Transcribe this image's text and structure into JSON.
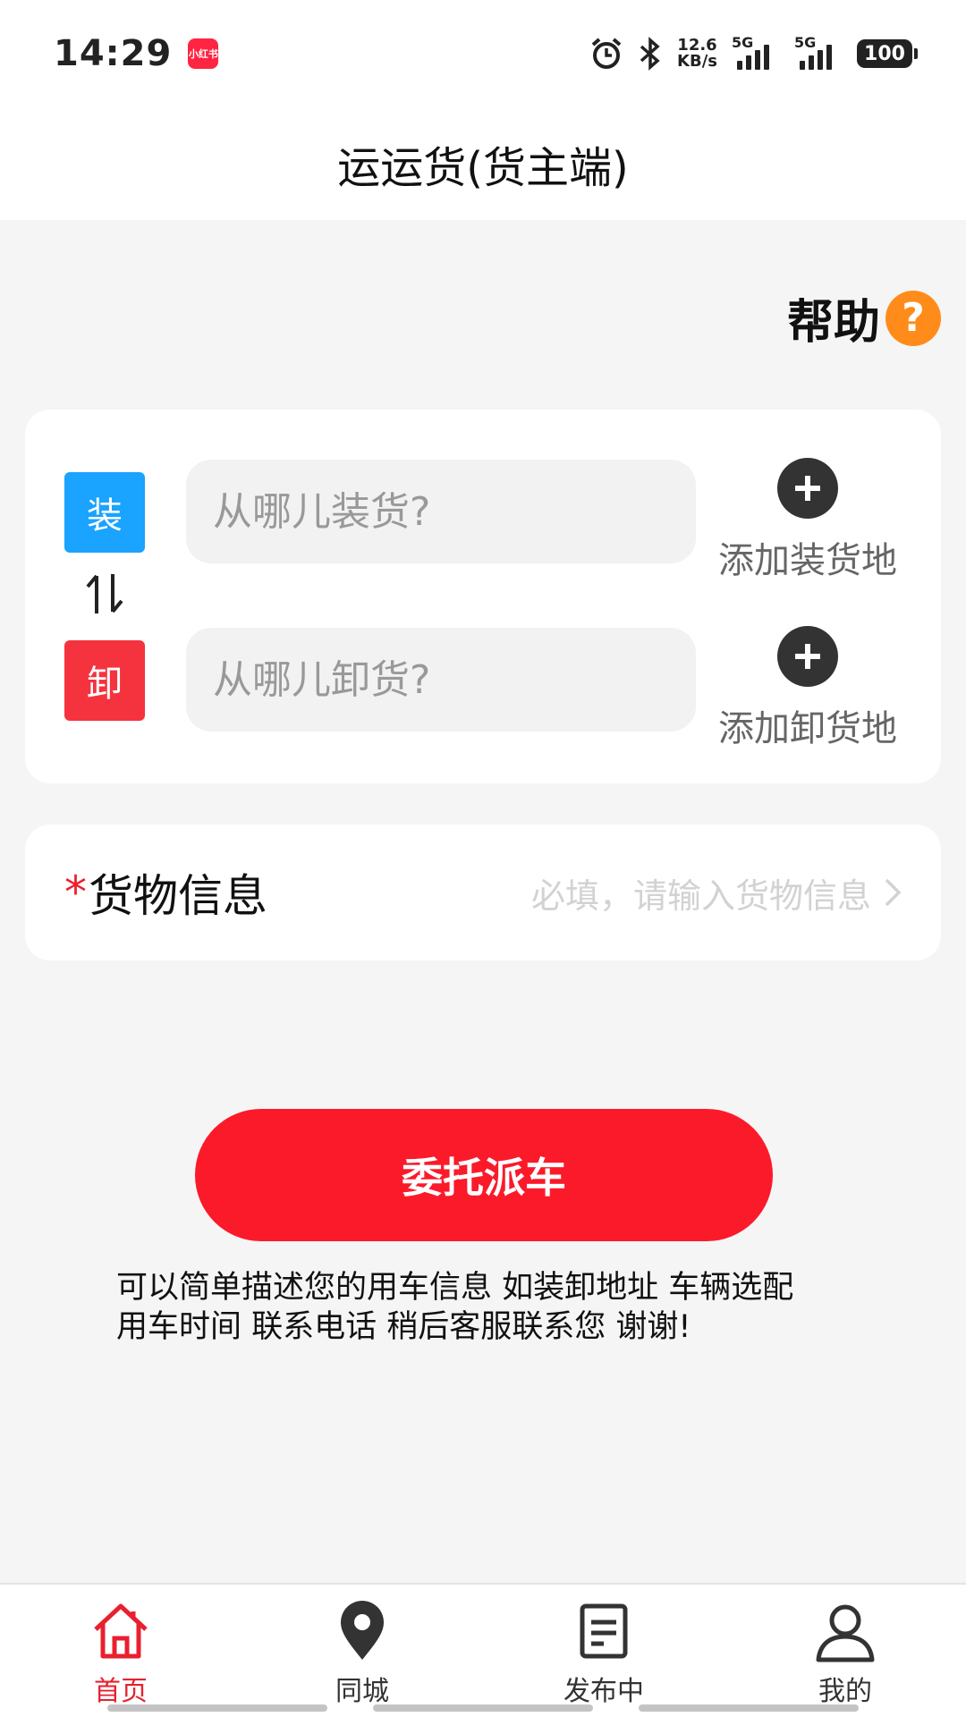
{
  "status_bar": {
    "time": "14:29",
    "app_icon_label": "小红书",
    "net_speed_value": "12.6",
    "net_speed_unit": "KB/s",
    "signal1_label": "5G",
    "signal2_label": "5G",
    "battery": "100"
  },
  "header": {
    "title": "运运货(货主端)"
  },
  "help": {
    "label": "帮助",
    "icon_glyph": "?"
  },
  "address": {
    "load_tag": "装",
    "unload_tag": "卸",
    "load_placeholder": "从哪儿装货?",
    "unload_placeholder": "从哪儿卸货?",
    "add_load_label": "添加装货地",
    "add_unload_label": "添加卸货地"
  },
  "cargo": {
    "required_mark": "*",
    "label": "货物信息",
    "placeholder": "必填，请输入货物信息"
  },
  "dispatch_button": {
    "label": "委托派车"
  },
  "note": {
    "line1": "可以简单描述您的用车信息 如装卸地址 车辆选配",
    "line2": "用车时间 联系电话 稍后客服联系您 谢谢!"
  },
  "nav": {
    "items": [
      {
        "label": "首页",
        "icon": "home-icon",
        "active": true
      },
      {
        "label": "同城",
        "icon": "location-pin-icon",
        "active": false
      },
      {
        "label": "发布中",
        "icon": "document-icon",
        "active": false
      },
      {
        "label": "我的",
        "icon": "user-icon",
        "active": false
      }
    ]
  },
  "colors": {
    "primary_red": "#fb1a2a",
    "load_blue": "#1aa3ff",
    "unload_red": "#f5333f",
    "help_orange": "#ff8c1a",
    "active_nav": "#e8202f"
  }
}
